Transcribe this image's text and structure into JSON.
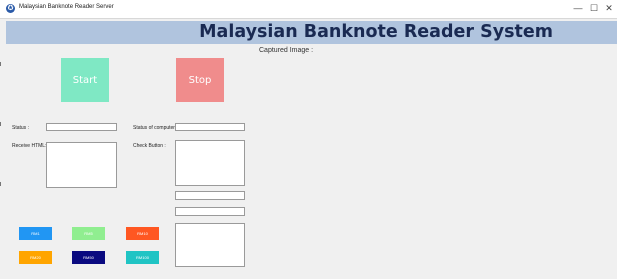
{
  "window": {
    "title": "Malaysian Banknote Reader Server",
    "icon": "app-icon",
    "controls": {
      "minimize": "—",
      "maximize": "☐",
      "close": "✕"
    }
  },
  "header": {
    "title": "Malaysian Banknote Reader System",
    "band_color": "#b0c4de"
  },
  "capture": {
    "label": "Captured Image :"
  },
  "main_buttons": {
    "start": {
      "label": "Start",
      "color": "#7fe8c4"
    },
    "stop": {
      "label": "Stop",
      "color": "#f08c8c"
    }
  },
  "left_panel": {
    "status_label": "Status :",
    "status_value": "",
    "receive_label": "Receive HTML:",
    "receive_value": ""
  },
  "right_panel": {
    "status_computer_label": "Status of computer :",
    "status_computer_value": "",
    "check_button_label": "Check Button :",
    "check_button_value": "",
    "field_1_value": "",
    "field_2_value": "",
    "output_value": ""
  },
  "denomination_buttons": [
    {
      "label": "RM1",
      "color": "#2196f3"
    },
    {
      "label": "RM5",
      "color": "#90ee90"
    },
    {
      "label": "RM10",
      "color": "#ff5722"
    },
    {
      "label": "RM20",
      "color": "#ffa500"
    },
    {
      "label": "RM50",
      "color": "#0a0a80"
    },
    {
      "label": "RM100",
      "color": "#20c4c4"
    }
  ]
}
